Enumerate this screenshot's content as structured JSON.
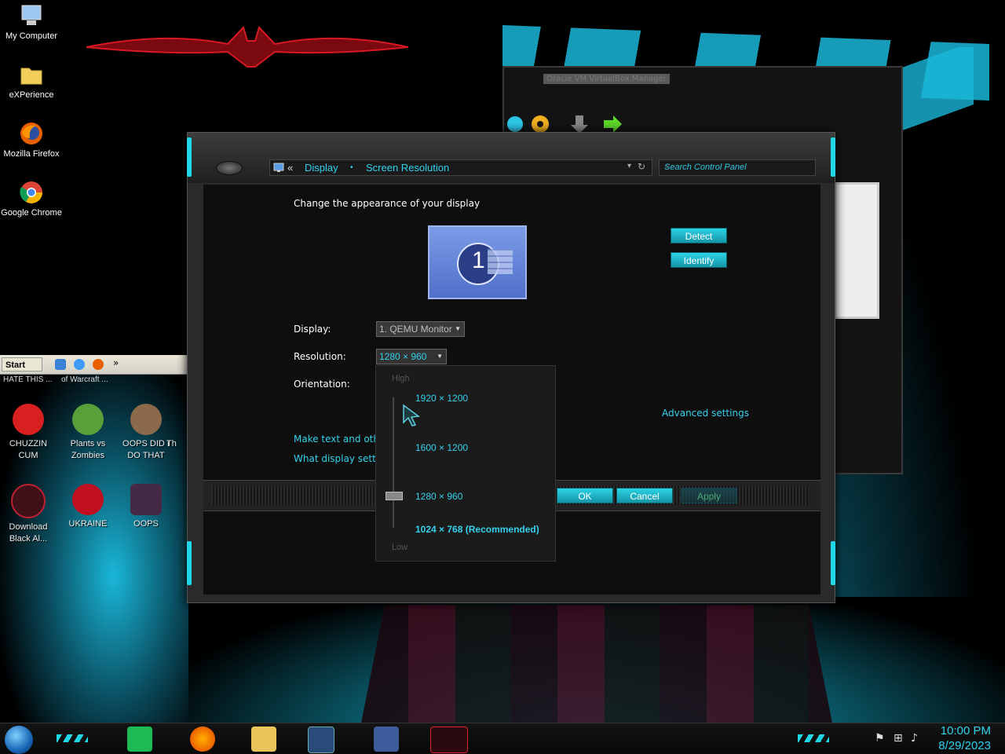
{
  "desktop": {
    "icons": [
      {
        "label": "My Computer"
      },
      {
        "label": "eXPerience"
      },
      {
        "label": "Mozilla Firefox"
      },
      {
        "label": "Google Chrome"
      }
    ]
  },
  "xp_window": {
    "start_label": "Start",
    "chevron": "»",
    "tasks": [
      "HATE THIS ...",
      "of Warcraft ..."
    ],
    "icons": [
      {
        "label": "CHUZZIN CUM"
      },
      {
        "label": "Plants vs Zombies"
      },
      {
        "label": "OOPS DID I DO THAT"
      },
      {
        "label": "Th"
      },
      {
        "label": "Download Black Al..."
      },
      {
        "label": "UKRAINE"
      },
      {
        "label": "OOPS"
      }
    ]
  },
  "vbox_window": {
    "title": "Oracle VM VirtualBox Manager"
  },
  "dialog": {
    "address": {
      "back_glyph": "«",
      "crumb1": "Display",
      "sep": "•",
      "crumb2": "Screen Resolution"
    },
    "search": {
      "placeholder": "Search Control Panel"
    },
    "heading": "Change the appearance of your display",
    "monitor_number": "1",
    "detect_label": "Detect",
    "identify_label": "Identify",
    "display_label": "Display:",
    "display_value": "1. QEMU Monitor",
    "resolution_label": "Resolution:",
    "resolution_value": "1280 × 960",
    "orientation_label": "Orientation:",
    "advanced_link": "Advanced settings",
    "link1": "Make text and other",
    "link2": "What display setting",
    "ok_label": "OK",
    "cancel_label": "Cancel",
    "apply_label": "Apply"
  },
  "resolution_popup": {
    "high_label": "High",
    "low_label": "Low",
    "options": [
      "1920 × 1200",
      "1600 × 1200",
      "1280 × 960",
      "1024 × 768 (Recommended)"
    ],
    "selected": "1280 × 960"
  },
  "taskbar": {
    "time": "10:00 PM",
    "date": "8/29/2023"
  }
}
